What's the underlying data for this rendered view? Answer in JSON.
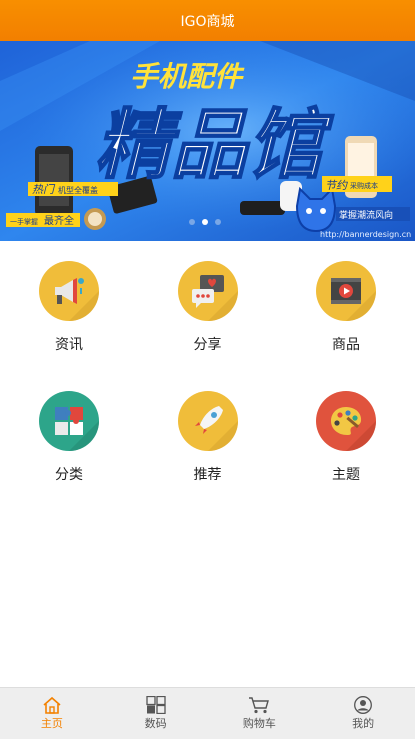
{
  "header": {
    "title": "IGO商城"
  },
  "banner": {
    "headline_top": "手机配件",
    "headline_main": "精品馆",
    "tag_hot": "热门",
    "tag_hot_sub": "机型全覆盖",
    "tag_one_stop": "一手掌握",
    "tag_complete": "最齐全",
    "tag_save": "节约",
    "tag_save_sub": "采购成本",
    "tag_trend": "掌握潮流风向",
    "watermark": "http://bannerdesign.cn",
    "carousel_count": 3,
    "carousel_active": 1
  },
  "features": [
    {
      "label": "资讯",
      "icon": "megaphone-icon",
      "color": "#f0bd3a"
    },
    {
      "label": "分享",
      "icon": "chat-heart-icon",
      "color": "#f0bd3a"
    },
    {
      "label": "商品",
      "icon": "video-play-icon",
      "color": "#f0bd3a"
    },
    {
      "label": "分类",
      "icon": "puzzle-icon",
      "color": "#2da58a"
    },
    {
      "label": "推荐",
      "icon": "rocket-icon",
      "color": "#f0bd3a"
    },
    {
      "label": "主题",
      "icon": "palette-icon",
      "color": "#e0533d"
    }
  ],
  "tabs": [
    {
      "label": "主页",
      "icon": "home-icon",
      "active": true
    },
    {
      "label": "数码",
      "icon": "grid-icon",
      "active": false
    },
    {
      "label": "购物车",
      "icon": "cart-icon",
      "active": false
    },
    {
      "label": "我的",
      "icon": "user-icon",
      "active": false
    }
  ],
  "colors": {
    "accent": "#f38100",
    "header": "#f88f00"
  }
}
